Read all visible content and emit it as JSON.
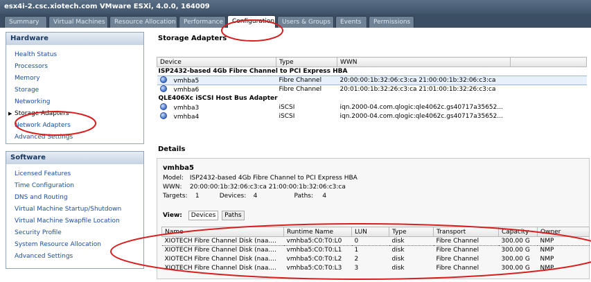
{
  "window": {
    "title": "esx4i-2.csc.xiotech.com VMware ESXi, 4.0.0, 164009"
  },
  "tabs": [
    {
      "label": "Summary",
      "active": false
    },
    {
      "label": "Virtual Machines",
      "active": false
    },
    {
      "label": "Resource Allocation",
      "active": false
    },
    {
      "label": "Performance",
      "active": false
    },
    {
      "label": "Configuration",
      "active": true
    },
    {
      "label": "Users & Groups",
      "active": false
    },
    {
      "label": "Events",
      "active": false
    },
    {
      "label": "Permissions",
      "active": false
    }
  ],
  "sidebar": {
    "hardware": {
      "header": "Hardware",
      "items": [
        {
          "label": "Health Status"
        },
        {
          "label": "Processors"
        },
        {
          "label": "Memory"
        },
        {
          "label": "Storage"
        },
        {
          "label": "Networking"
        },
        {
          "label": "Storage Adapters",
          "selected": true
        },
        {
          "label": "Network Adapters"
        },
        {
          "label": "Advanced Settings"
        }
      ]
    },
    "software": {
      "header": "Software",
      "items": [
        {
          "label": "Licensed Features"
        },
        {
          "label": "Time Configuration"
        },
        {
          "label": "DNS and Routing"
        },
        {
          "label": "Virtual Machine Startup/Shutdown"
        },
        {
          "label": "Virtual Machine Swapfile Location"
        },
        {
          "label": "Security Profile"
        },
        {
          "label": "System Resource Allocation"
        },
        {
          "label": "Advanced Settings"
        }
      ]
    }
  },
  "storage_adapters": {
    "title": "Storage Adapters",
    "columns": [
      "Device",
      "Type",
      "WWN"
    ],
    "groups": [
      {
        "name": "ISP2432-based 4Gb Fibre Channel to PCI Express HBA",
        "rows": [
          {
            "device": "vmhba5",
            "type": "Fibre Channel",
            "wwn": "20:00:00:1b:32:06:c3:ca 21:00:00:1b:32:06:c3:ca",
            "selected": true
          },
          {
            "device": "vmhba6",
            "type": "Fibre Channel",
            "wwn": "20:01:00:1b:32:26:c3:ca 21:01:00:1b:32:26:c3:ca"
          }
        ]
      },
      {
        "name": "QLE406Xc iSCSI Host Bus Adapter",
        "rows": [
          {
            "device": "vmhba3",
            "type": "iSCSI",
            "wwn": "iqn.2000-04.com.qlogic:qle4062c.gs40717a35652..."
          },
          {
            "device": "vmhba4",
            "type": "iSCSI",
            "wwn": "iqn.2000-04.com.qlogic:qle4062c.gs40717a35652..."
          }
        ]
      }
    ]
  },
  "details": {
    "title": "Details",
    "device": "vmhba5",
    "model_label": "Model:",
    "model": "ISP2432-based 4Gb Fibre Channel to PCI Express HBA",
    "wwn_label": "WWN:",
    "wwn": "20:00:00:1b:32:06:c3:ca 21:00:00:1b:32:06:c3:ca",
    "targets_label": "Targets:",
    "targets": "1",
    "devices_label": "Devices:",
    "devices": "4",
    "paths_label": "Paths:",
    "paths": "4",
    "view_label": "View:",
    "view_devices": "Devices",
    "view_paths": "Paths",
    "columns": [
      "Name",
      "Runtime Name",
      "LUN",
      "Type",
      "Transport",
      "Capacity",
      "Owner"
    ],
    "rows": [
      {
        "name": "XIOTECH Fibre Channel Disk (naa....",
        "runtime": "vmhba5:C0:T0:L0",
        "lun": "0",
        "type": "disk",
        "transport": "Fibre Channel",
        "capacity": "300.00 G",
        "owner": "NMP",
        "selected": true
      },
      {
        "name": "XIOTECH Fibre Channel Disk (naa....",
        "runtime": "vmhba5:C0:T0:L1",
        "lun": "1",
        "type": "disk",
        "transport": "Fibre Channel",
        "capacity": "300.00 G",
        "owner": "NMP"
      },
      {
        "name": "XIOTECH Fibre Channel Disk (naa....",
        "runtime": "vmhba5:C0:T0:L2",
        "lun": "2",
        "type": "disk",
        "transport": "Fibre Channel",
        "capacity": "300.00 G",
        "owner": "NMP"
      },
      {
        "name": "XIOTECH Fibre Channel Disk (naa....",
        "runtime": "vmhba5:C0:T0:L3",
        "lun": "3",
        "type": "disk",
        "transport": "Fibre Channel",
        "capacity": "300.00 G",
        "owner": "NMP"
      }
    ]
  },
  "colors": {
    "annotation": "#d81e1e",
    "header_blue": "#17365d",
    "link_blue": "#1a4ea0"
  }
}
